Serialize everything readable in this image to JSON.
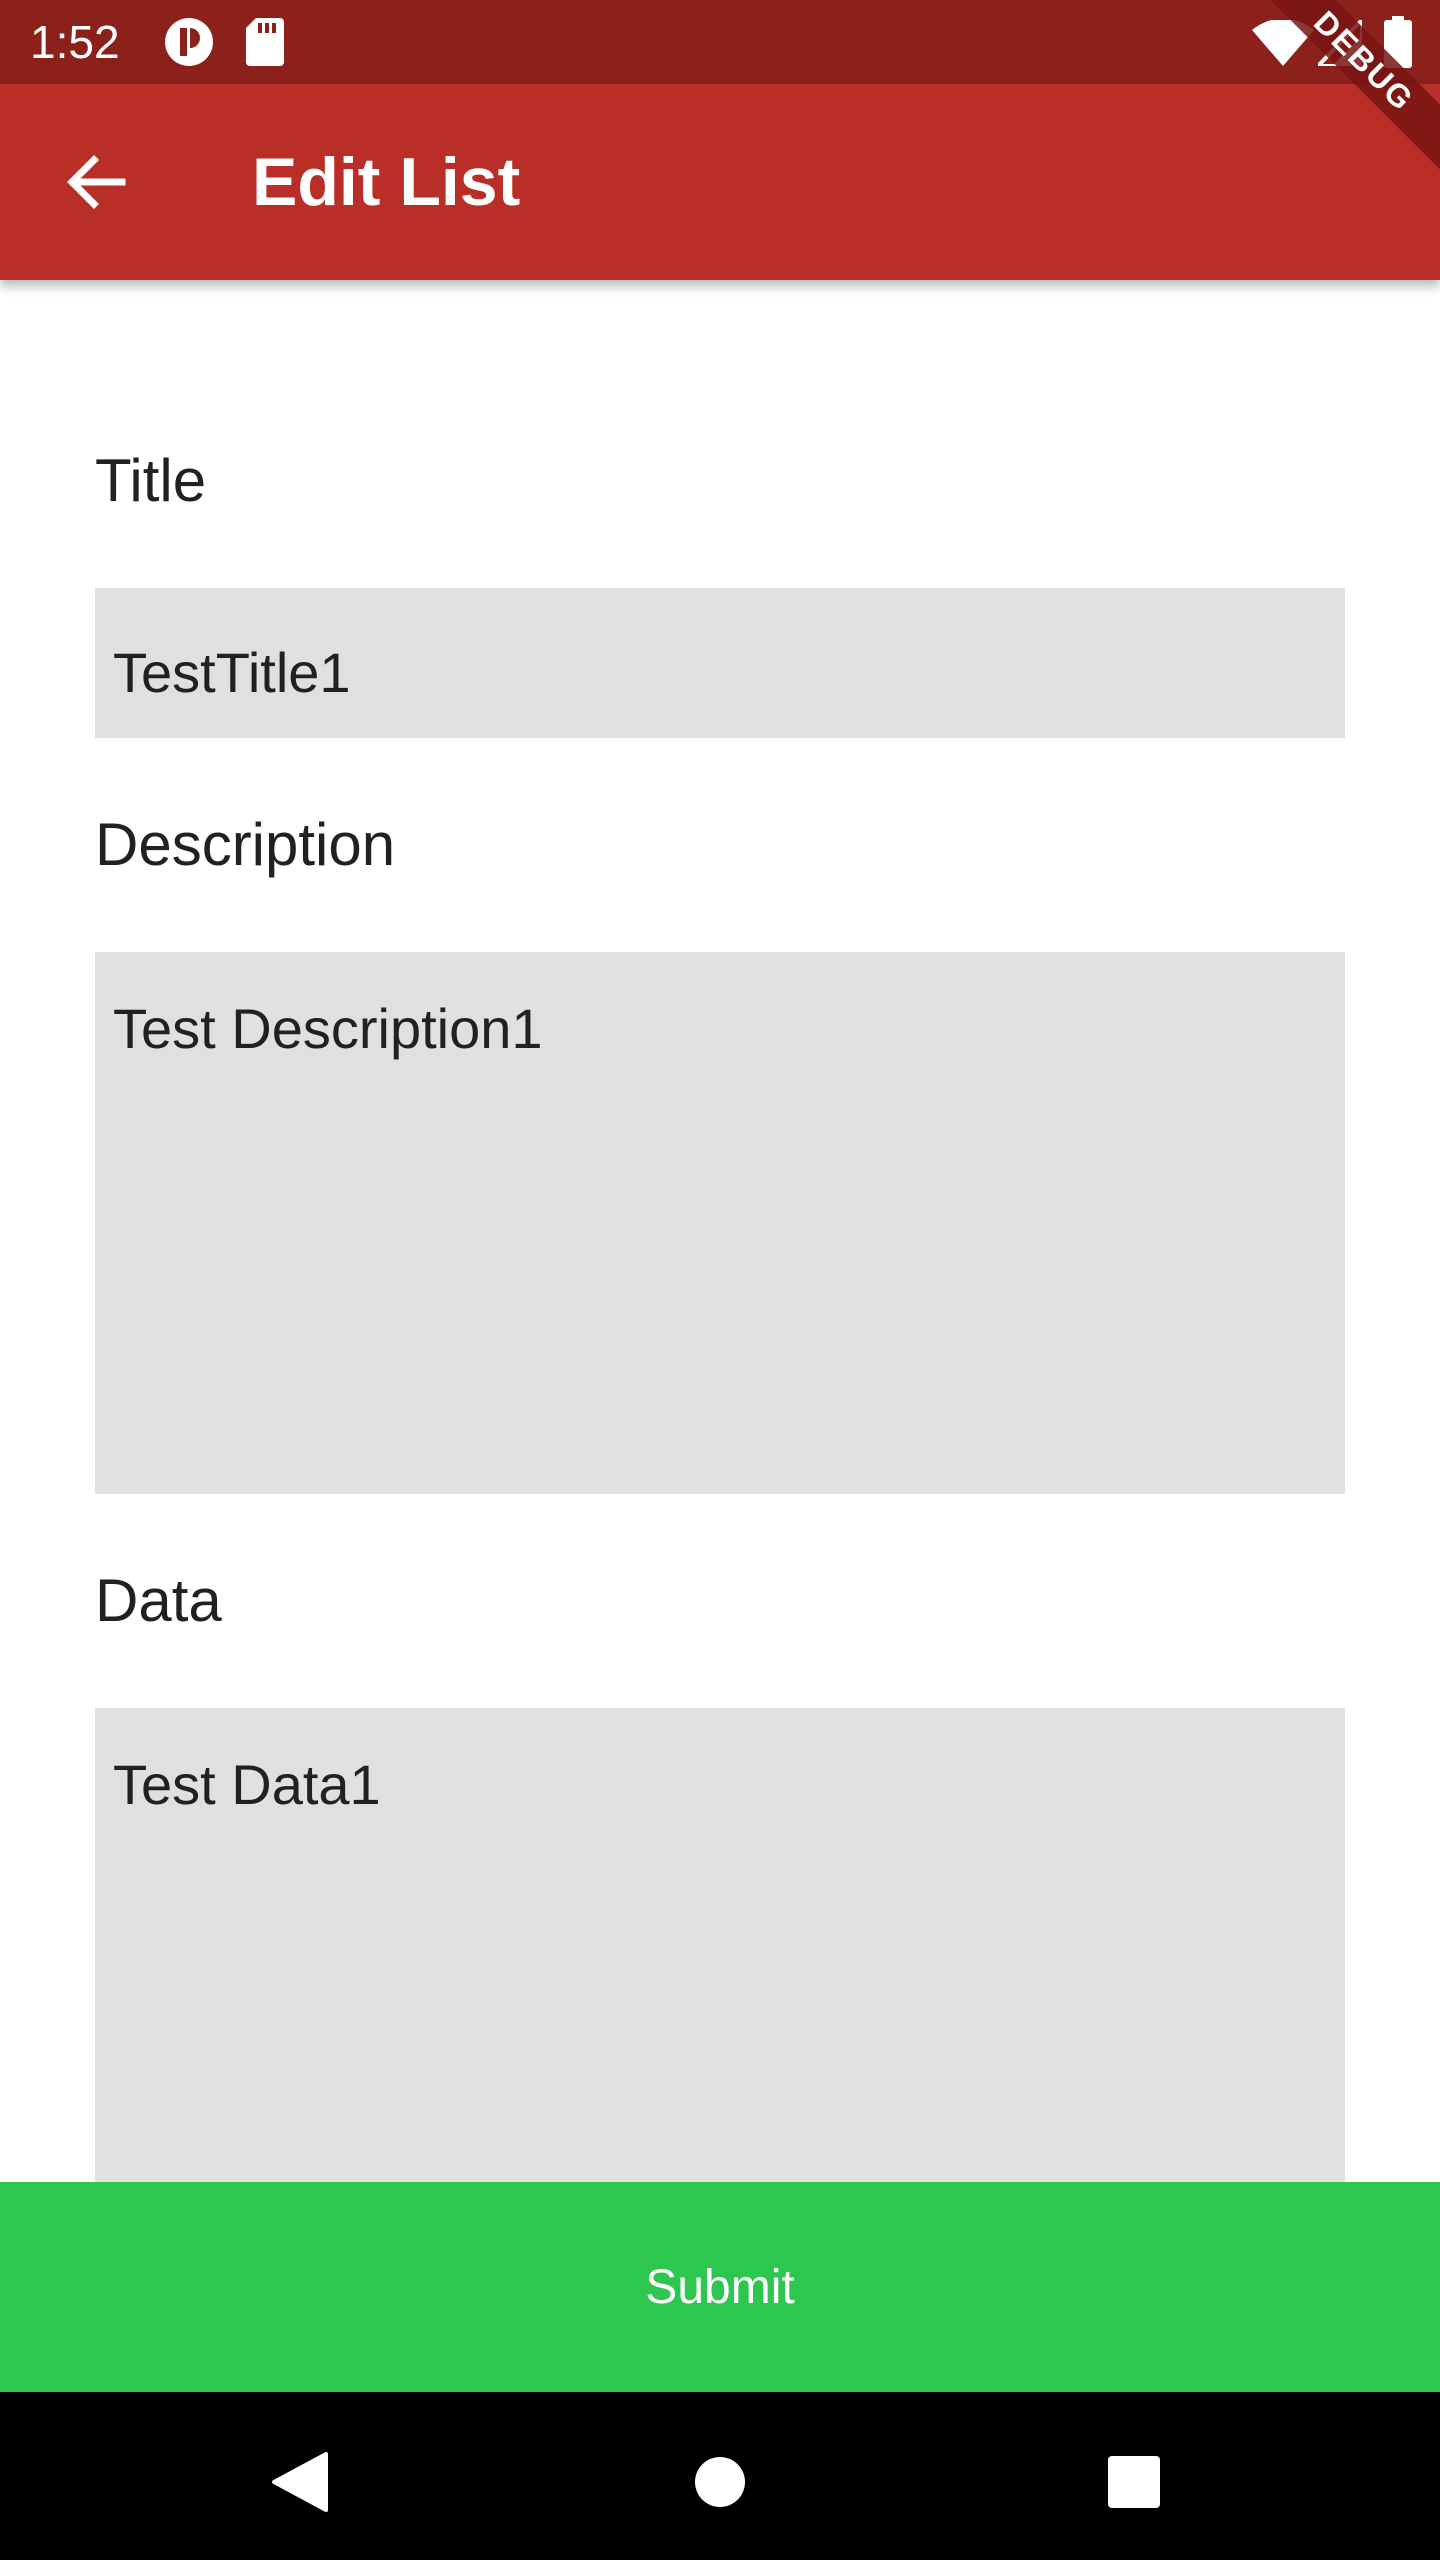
{
  "status_bar": {
    "time": "1:52",
    "icons": [
      "app-notification-icon",
      "sd-card-icon",
      "wifi-icon",
      "cell-signal-icon",
      "battery-icon"
    ],
    "background": "#8c211c"
  },
  "app_bar": {
    "title": "Edit List",
    "back_icon": "back-arrow-icon",
    "background": "#b92e26"
  },
  "debug_banner": {
    "label": "DEBUG"
  },
  "form": {
    "title_label": "Title",
    "title_value": "TestTitle1",
    "description_label": "Description",
    "description_value": "Test Description1",
    "data_label": "Data",
    "data_value": "Test Data1",
    "field_background": "#e0e0e0"
  },
  "submit": {
    "label": "Submit",
    "background": "#2dc74f"
  },
  "nav_bar": {
    "buttons": [
      "nav-back-icon",
      "nav-home-icon",
      "nav-recents-icon"
    ]
  }
}
